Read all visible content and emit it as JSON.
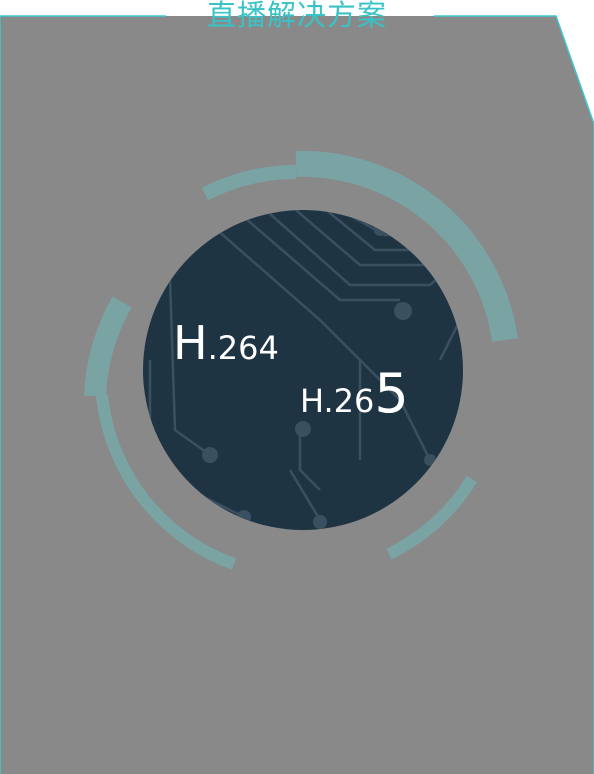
{
  "header": {
    "title": "直播解决方案"
  },
  "colors": {
    "panel_fill": "#898989",
    "panel_border": "#3ec8cc",
    "title_color": "#39c3c6",
    "ring_color": "#7aa3a4",
    "disc_color": "#1f3443",
    "trace_color": "#3a5061"
  },
  "codecs": {
    "h264": {
      "prefix": "H",
      "rest": ".264"
    },
    "h265": {
      "prefix": "H.26",
      "suffix": "5"
    }
  }
}
